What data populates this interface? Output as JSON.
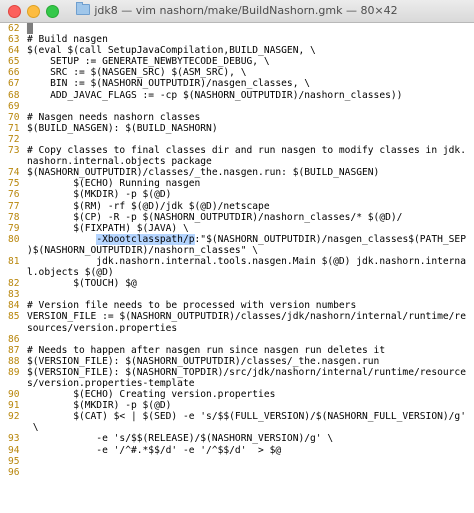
{
  "window": {
    "title": "jdk8 — vim nashorn/make/BuildNashorn.gmk — 80×42"
  },
  "editor": {
    "lines": [
      {
        "num": "62",
        "text": "█"
      },
      {
        "num": "63",
        "text": "# Build nasgen"
      },
      {
        "num": "64",
        "text": "$(eval $(call SetupJavaCompilation,BUILD_NASGEN, \\"
      },
      {
        "num": "65",
        "text": "    SETUP := GENERATE_NEWBYTECODE_DEBUG, \\"
      },
      {
        "num": "66",
        "text": "    SRC := $(NASGEN_SRC) $(ASM_SRC), \\"
      },
      {
        "num": "67",
        "text": "    BIN := $(NASHORN_OUTPUTDIR)/nasgen_classes, \\"
      },
      {
        "num": "68",
        "text": "    ADD_JAVAC_FLAGS := -cp $(NASHORN_OUTPUTDIR)/nashorn_classes))"
      },
      {
        "num": "69",
        "text": ""
      },
      {
        "num": "70",
        "text": "# Nasgen needs nashorn classes"
      },
      {
        "num": "71",
        "text": "$(BUILD_NASGEN): $(BUILD_NASHORN)"
      },
      {
        "num": "72",
        "text": ""
      },
      {
        "num": "73",
        "text": "# Copy classes to final classes dir and run nasgen to modify classes in jdk."
      },
      {
        "num": "",
        "text": "nashorn.internal.objects package"
      },
      {
        "num": "74",
        "text": "$(NASHORN_OUTPUTDIR)/classes/_the.nasgen.run: $(BUILD_NASGEN)"
      },
      {
        "num": "75",
        "text": "        $(ECHO) Running nasgen"
      },
      {
        "num": "76",
        "text": "        $(MKDIR) -p $(@D)"
      },
      {
        "num": "77",
        "text": "        $(RM) -rf $(@D)/jdk $(@D)/netscape"
      },
      {
        "num": "78",
        "text": "        $(CP) -R -p $(NASHORN_OUTPUTDIR)/nashorn_classes/* $(@D)/"
      },
      {
        "num": "79",
        "text": "        $(FIXPATH) $(JAVA) \\"
      },
      {
        "num": "80",
        "pre": "            ",
        "hl": "-Xbootclasspath/p",
        "text": ":\"$(NASHORN_OUTPUTDIR)/nasgen_classes$(PATH_SEP"
      },
      {
        "num": "",
        "text": ")$(NASHORN_OUTPUTDIR)/nashorn_classes\" \\"
      },
      {
        "num": "81",
        "text": "            jdk.nashorn.internal.tools.nasgen.Main $(@D) jdk.nashorn.interna"
      },
      {
        "num": "",
        "text": "l.objects $(@D)"
      },
      {
        "num": "82",
        "text": "        $(TOUCH) $@"
      },
      {
        "num": "83",
        "text": ""
      },
      {
        "num": "84",
        "text": "# Version file needs to be processed with version numbers"
      },
      {
        "num": "85",
        "text": "VERSION_FILE := $(NASHORN_OUTPUTDIR)/classes/jdk/nashorn/internal/runtime/re"
      },
      {
        "num": "",
        "text": "sources/version.properties"
      },
      {
        "num": "86",
        "text": ""
      },
      {
        "num": "87",
        "text": "# Needs to happen after nasgen run since nasgen run deletes it"
      },
      {
        "num": "88",
        "text": "$(VERSION_FILE): $(NASHORN_OUTPUTDIR)/classes/_the.nasgen.run"
      },
      {
        "num": "89",
        "text": "$(VERSION_FILE): $(NASHORN_TOPDIR)/src/jdk/nashorn/internal/runtime/resource"
      },
      {
        "num": "",
        "text": "s/version.properties-template"
      },
      {
        "num": "90",
        "text": "        $(ECHO) Creating version.properties"
      },
      {
        "num": "91",
        "text": "        $(MKDIR) -p $(@D)"
      },
      {
        "num": "92",
        "text": "        $(CAT) $< | $(SED) -e 's/$$(FULL_VERSION)/$(NASHORN_FULL_VERSION)/g'"
      },
      {
        "num": "",
        "text": " \\"
      },
      {
        "num": "93",
        "text": "            -e 's/$$(RELEASE)/$(NASHORN_VERSION)/g' \\"
      },
      {
        "num": "94",
        "text": "            -e '/^#.*$$/d' -e '/^$$/d'  > $@"
      },
      {
        "num": "95",
        "text": ""
      },
      {
        "num": "96",
        "text": ""
      }
    ]
  }
}
